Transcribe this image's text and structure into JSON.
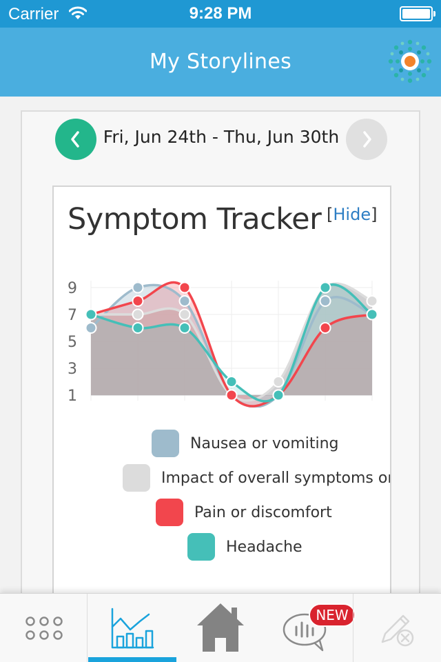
{
  "status_bar": {
    "carrier": "Carrier",
    "time": "9:28 PM"
  },
  "nav": {
    "title": "My Storylines"
  },
  "date_nav": {
    "range": "Fri, Jun 24th - Thu, Jun 30th"
  },
  "card": {
    "title": "Symptom Tracker",
    "hide_open": "[",
    "hide_label": "Hide",
    "hide_close": "]"
  },
  "chart_data": {
    "type": "area",
    "title": "Symptom Tracker",
    "x": [
      1,
      2,
      3,
      4,
      5,
      6,
      7
    ],
    "y_ticks": [
      1,
      3,
      5,
      7,
      9
    ],
    "ylim": [
      1,
      9
    ],
    "grid": true,
    "legend_position": "bottom",
    "series": [
      {
        "name": "Nausea or vomiting",
        "color": "#9ebbcc",
        "values": [
          6,
          9,
          8,
          1,
          1,
          8,
          7
        ]
      },
      {
        "name": "Impact of overall symptoms on my day",
        "color": "#dcdcdc",
        "values": [
          7,
          7,
          7,
          1,
          2,
          9,
          8
        ]
      },
      {
        "name": "Pain or discomfort",
        "color": "#f2464d",
        "values": [
          7,
          8,
          9,
          1,
          1,
          6,
          7
        ]
      },
      {
        "name": "Headache",
        "color": "#45bfb8",
        "values": [
          7,
          6,
          6,
          2,
          1,
          9,
          7
        ]
      }
    ]
  },
  "tabs": {
    "menu_icon": "grid-dots-icon",
    "storylines_icon": "bar-chart-icon",
    "home_icon": "home-icon",
    "messages_icon": "chat-bubble-icon",
    "messages_badge": "NEW",
    "edit_icon": "pencil-cancel-icon"
  },
  "colors": {
    "status_bar": "#1f98d3",
    "nav_bar": "#4aaedf",
    "prev_button": "#23b68b",
    "next_button": "#e0e0e0",
    "link": "#2d7ec4",
    "badge": "#d9232e",
    "active_tab": "#1aa3dc"
  }
}
